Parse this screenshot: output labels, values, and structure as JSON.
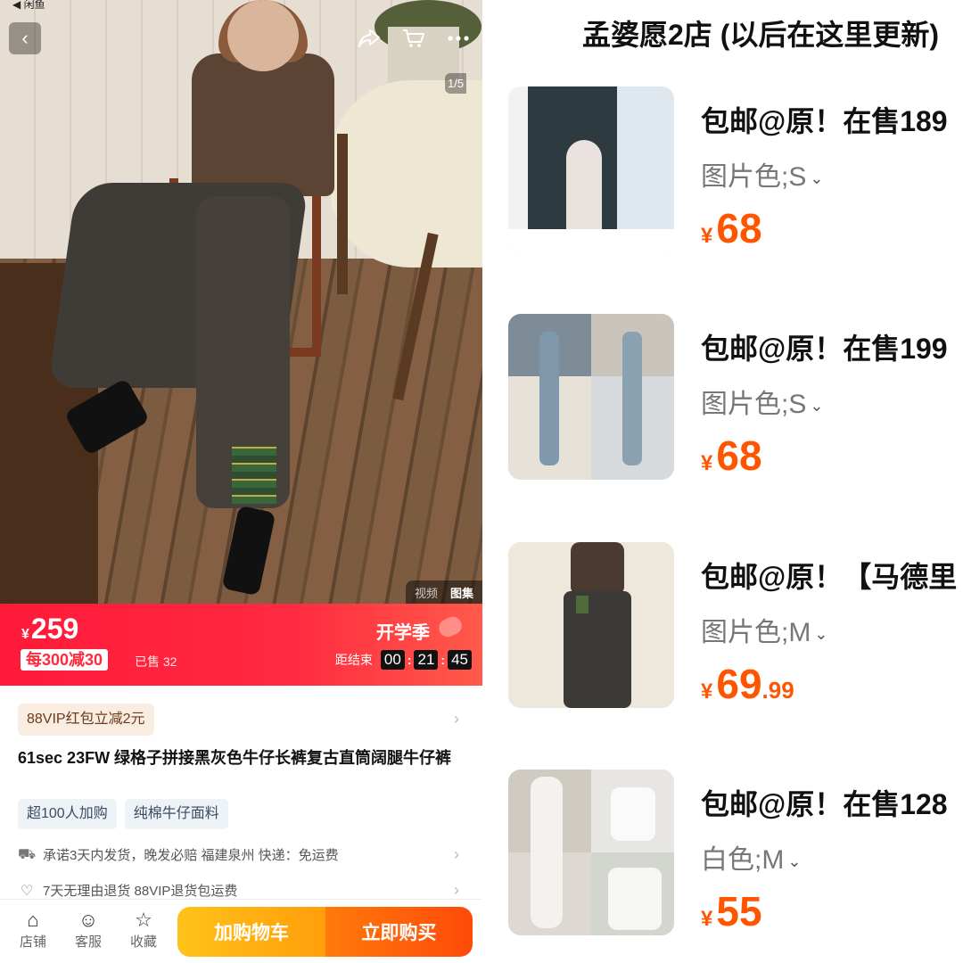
{
  "left": {
    "status": {
      "back_text": "◀ 闲鱼"
    },
    "hero": {
      "counter": "1/5",
      "media_tabs": [
        "视频",
        "图集"
      ]
    },
    "price": {
      "currency": "¥",
      "amount": "259",
      "coupon": "每300减30",
      "sold": "已售 32",
      "campaign": "开学季",
      "countdown_label": "距结束",
      "countdown": [
        "00",
        "21",
        "45"
      ]
    },
    "vip_text": "88VIP红包立减2元",
    "title": "61sec 23FW 绿格子拼接黑灰色牛仔长裤复古直筒阔腿牛仔裤",
    "tags": [
      "超100人加购",
      "纯棉牛仔面料"
    ],
    "shipping": "承诺3天内发货，晚发必赔  福建泉州  快递：免运费",
    "returns": "7天无理由退货  88VIP退货包运费",
    "bottom_nav": [
      {
        "label": "店铺",
        "icon": "store-icon"
      },
      {
        "label": "客服",
        "icon": "service-icon"
      },
      {
        "label": "收藏",
        "icon": "star-icon"
      }
    ],
    "add_cart": "加购物车",
    "buy_now": "立即购买"
  },
  "right": {
    "shop_title": "孟婆愿2店 (以后在这里更新)",
    "items": [
      {
        "title": "包邮@原！在售189",
        "variant": "图片色;S",
        "currency": "¥",
        "price_int": "68",
        "price_dec": ""
      },
      {
        "title": "包邮@原！在售199",
        "variant": "图片色;S",
        "currency": "¥",
        "price_int": "68",
        "price_dec": ""
      },
      {
        "title": "包邮@原！【马德里",
        "variant": "图片色;M",
        "currency": "¥",
        "price_int": "69",
        "price_dec": ".99"
      },
      {
        "title": "包邮@原！在售128",
        "variant": "白色;M",
        "currency": "¥",
        "price_int": "55",
        "price_dec": ""
      }
    ]
  },
  "colors": {
    "price_red": "#ff2a40",
    "accent_orange": "#ff5500",
    "cart_yellow": "#ffc21a",
    "buy_orange": "#ff5a0a"
  }
}
